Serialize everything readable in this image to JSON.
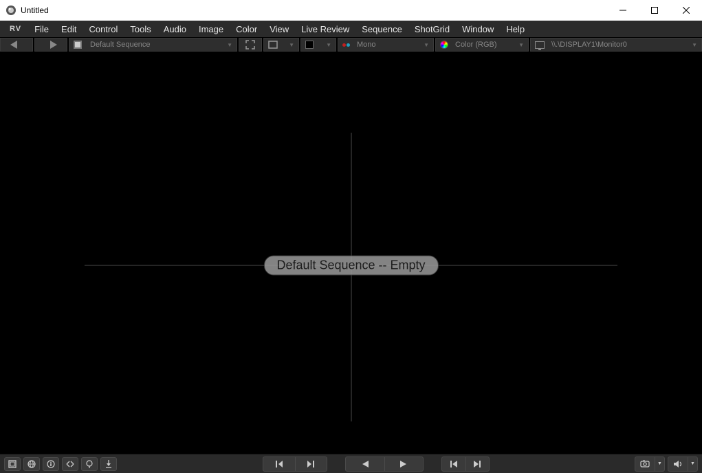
{
  "window": {
    "title": "Untitled"
  },
  "menu": {
    "logo": "RV",
    "items": [
      "File",
      "Edit",
      "Control",
      "Tools",
      "Audio",
      "Image",
      "Color",
      "View",
      "Live Review",
      "Sequence",
      "ShotGrid",
      "Window",
      "Help"
    ]
  },
  "toolbar": {
    "sequence_label": "Default Sequence",
    "stereo_label": "Mono",
    "color_label": "Color (RGB)",
    "display_label": "\\\\.\\DISPLAY1\\Monitor0"
  },
  "viewport": {
    "overlay_text": "Default Sequence -- Empty"
  }
}
